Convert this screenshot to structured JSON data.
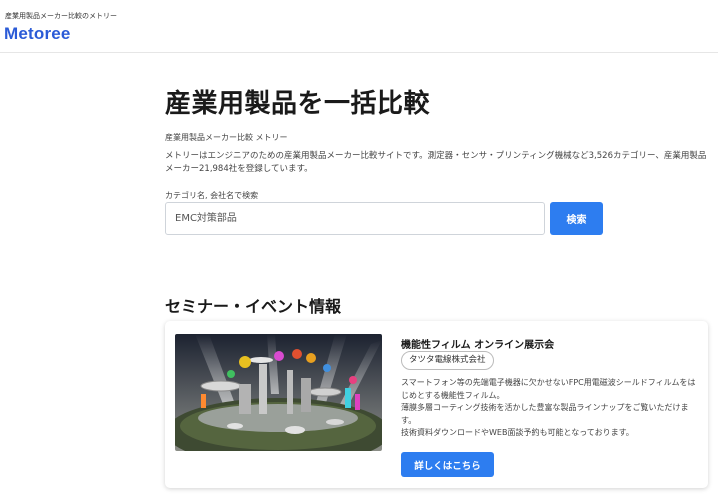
{
  "header": {
    "tagline": "産業用製品メーカー比較のメトリー",
    "logo": "Metoree",
    "brand_color": "#2b5bd7"
  },
  "hero": {
    "title": "産業用製品を一括比較",
    "subtitle": "産業用製品メーカー比較 メトリー",
    "description": "メトリーはエンジニアのための産業用製品メーカー比較サイトです。測定器・センサ・プリンティング機械など3,526カテゴリー、産業用製品メーカー21,984社を登録しています。"
  },
  "search": {
    "label": "カテゴリ名, 会社名で検索",
    "placeholder": "EMC対策部品",
    "value": "",
    "button_label": "検索",
    "button_color": "#2d7df0"
  },
  "seminar": {
    "section_title": "セミナー・イベント情報",
    "events": [
      {
        "title": "機能性フィルム オンライン展示会",
        "company": "タツタ電線株式会社",
        "description_lines": [
          "スマートフォン等の先端電子機器に欠かせないFPC用電磁波シールドフィルムをはじめとする機能性フィルム。",
          "薄膜多層コーティング技術を活かした豊富な製品ラインナップをご覧いただけます。",
          "技術資料ダウンロードやWEB面談予約も可能となっております。"
        ],
        "button_label": "詳しくはこちら",
        "image_icon": "virtual-exhibition-illustration"
      }
    ]
  }
}
